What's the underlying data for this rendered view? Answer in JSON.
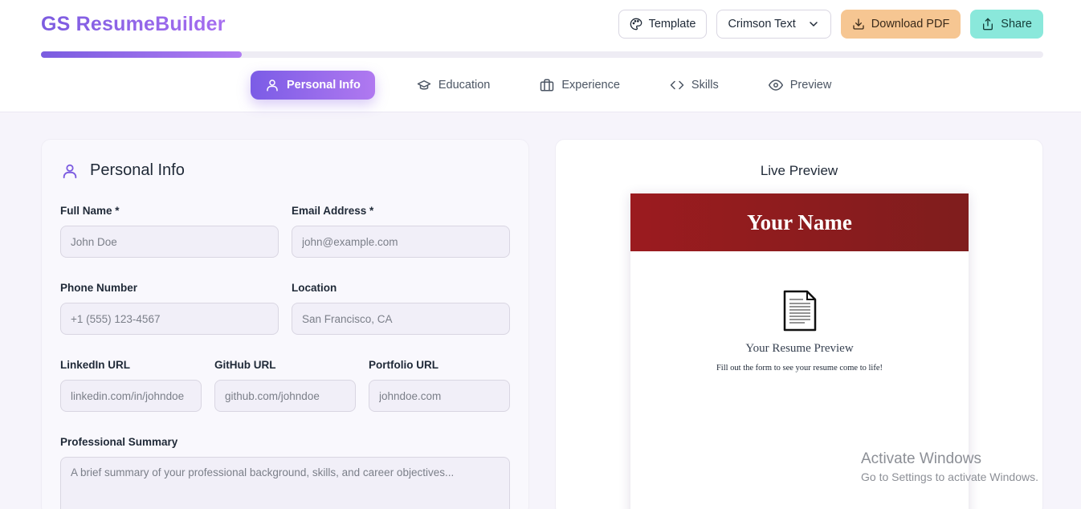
{
  "header": {
    "brand": "GS ResumeBuilder",
    "toolbar": {
      "template_label": "Template",
      "font_label": "Crimson Text",
      "download_label": "Download PDF",
      "share_label": "Share"
    },
    "progress_fraction": 0.2
  },
  "tabs": [
    {
      "label": "Personal Info",
      "icon": "user-icon",
      "active": true
    },
    {
      "label": "Education",
      "icon": "graduation-cap-icon",
      "active": false
    },
    {
      "label": "Experience",
      "icon": "briefcase-icon",
      "active": false
    },
    {
      "label": "Skills",
      "icon": "code-icon",
      "active": false
    },
    {
      "label": "Preview",
      "icon": "eye-icon",
      "active": false
    }
  ],
  "form": {
    "title": "Personal Info",
    "full_name": {
      "label": "Full Name *",
      "placeholder": "John Doe",
      "value": ""
    },
    "email": {
      "label": "Email Address *",
      "placeholder": "john@example.com",
      "value": ""
    },
    "phone": {
      "label": "Phone Number",
      "placeholder": "+1 (555) 123-4567",
      "value": ""
    },
    "location": {
      "label": "Location",
      "placeholder": "San Francisco, CA",
      "value": ""
    },
    "linkedin": {
      "label": "LinkedIn URL",
      "placeholder": "linkedin.com/in/johndoe",
      "value": ""
    },
    "github": {
      "label": "GitHub URL",
      "placeholder": "github.com/johndoe",
      "value": ""
    },
    "portfolio": {
      "label": "Portfolio URL",
      "placeholder": "johndoe.com",
      "value": ""
    },
    "summary": {
      "label": "Professional Summary",
      "placeholder": "A brief summary of your professional background, skills, and career objectives...",
      "value": ""
    }
  },
  "preview": {
    "title": "Live Preview",
    "resume_name": "Your Name",
    "empty_title": "Your Resume Preview",
    "empty_subtitle": "Fill out the form to see your resume come to life!"
  },
  "watermark": {
    "title": "Activate Windows",
    "subtitle": "Go to Settings to activate Windows."
  },
  "colors": {
    "accent": "#7c5ce0",
    "download": "#f6c692",
    "share": "#8ae8db",
    "resume_header": "#9b1b1f"
  }
}
